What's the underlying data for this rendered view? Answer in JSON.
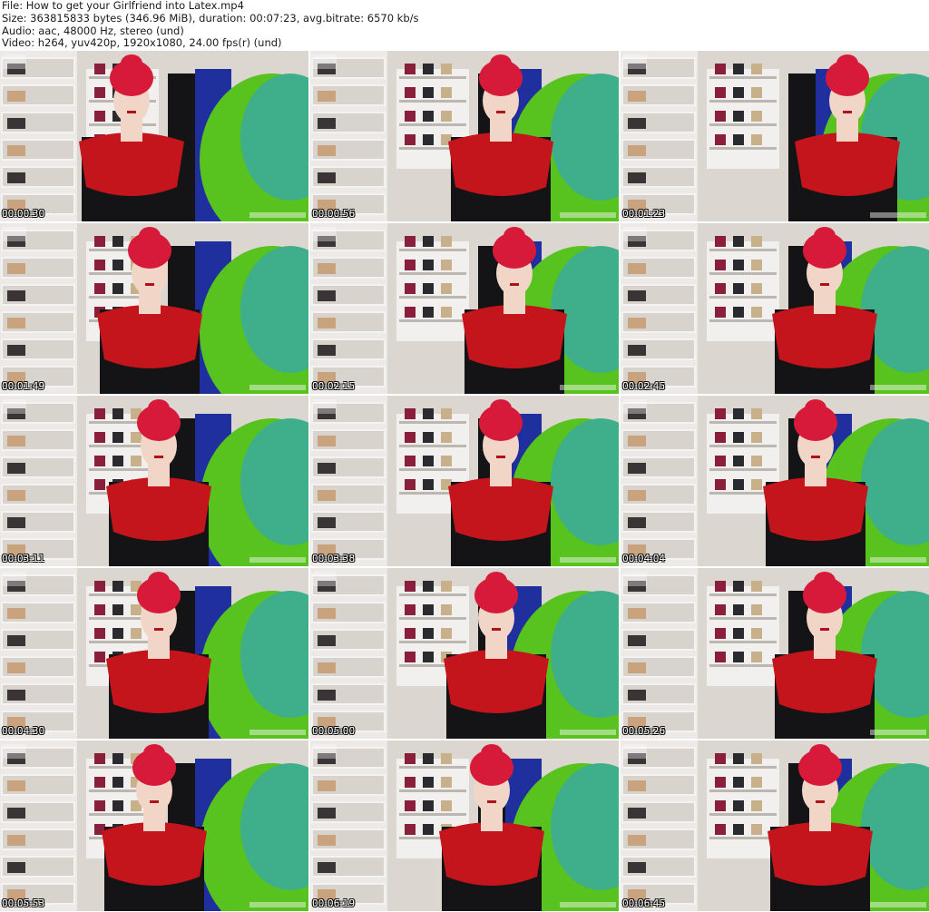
{
  "header": {
    "file": "File: How to get your Girlfriend into Latex.mp4",
    "size": "Size: 363815833 bytes (346.96 MiB), duration: 00:07:23, avg.bitrate: 6570 kb/s",
    "audio": "Audio: aac, 48000 Hz, stereo (und)",
    "video": "Video: h264, yuv420p, 1920x1080, 24.00 fps(r) (und)"
  },
  "thumbnails": [
    {
      "timestamp": "00:00:30"
    },
    {
      "timestamp": "00:00:56"
    },
    {
      "timestamp": "00:01:23"
    },
    {
      "timestamp": "00:01:49"
    },
    {
      "timestamp": "00:02:15"
    },
    {
      "timestamp": "00:02:45"
    },
    {
      "timestamp": "00:03:11"
    },
    {
      "timestamp": "00:03:38"
    },
    {
      "timestamp": "00:04:04"
    },
    {
      "timestamp": "00:04:30"
    },
    {
      "timestamp": "00:05:00"
    },
    {
      "timestamp": "00:05:26"
    },
    {
      "timestamp": "00:05:53"
    },
    {
      "timestamp": "00:06:19"
    },
    {
      "timestamp": "00:06:45"
    }
  ],
  "colors": {
    "wall": "#dcd6d1",
    "shelf": "#ece9e6",
    "latex_red": "#c4141c",
    "latex_black": "#141416",
    "hair": "#d81a3a",
    "green_dress": "#58c21e",
    "teal_dress": "#3fae8a",
    "blue_dress": "#1f2f9e",
    "skin": "#f1d6c8"
  }
}
